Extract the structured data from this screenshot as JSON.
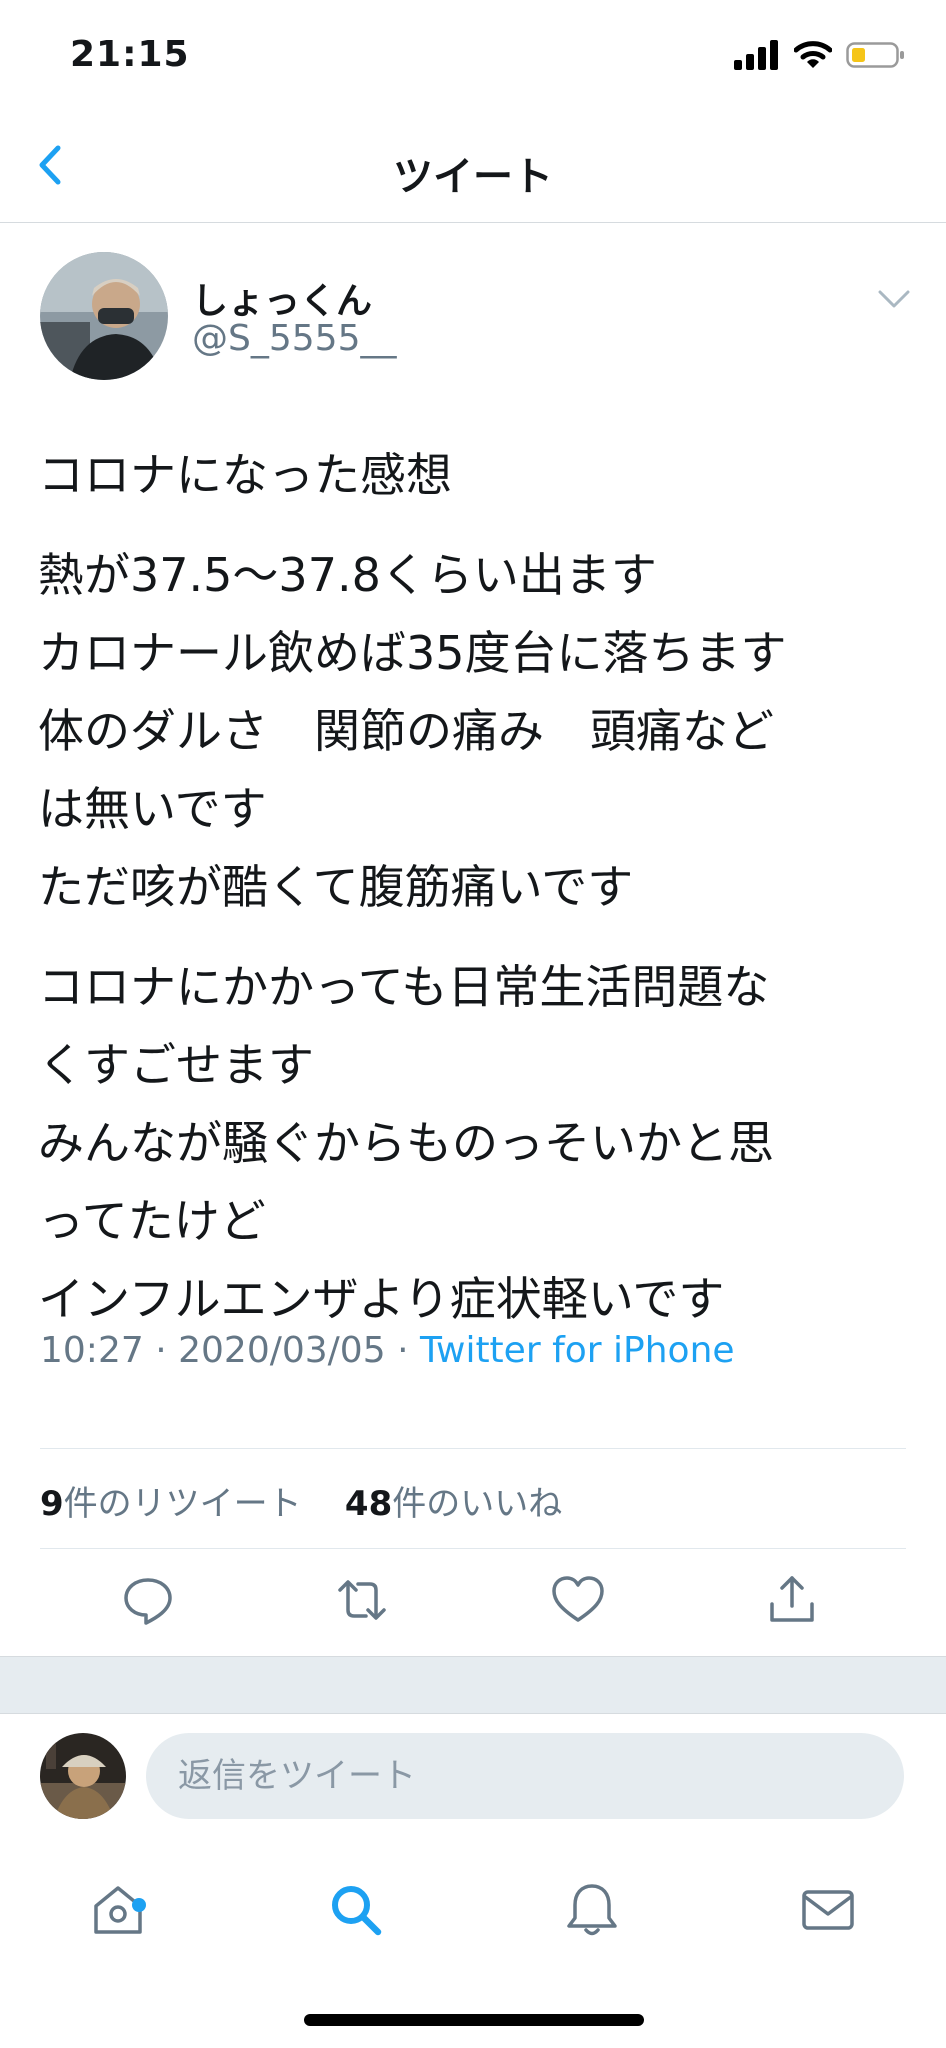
{
  "status_bar": {
    "time": "21:15"
  },
  "nav": {
    "title": "ツイート"
  },
  "tweet": {
    "display_name": "しょっくん",
    "handle": "@S_5555__",
    "paragraphs": [
      [
        "コロナになった感想"
      ],
      [
        "熱が37.5〜37.8くらい出ます",
        "カロナール飲めば35度台に落ちます",
        "体のダルさ　関節の痛み　頭痛など",
        "は無いです",
        "ただ咳が酷くて腹筋痛いです"
      ],
      [
        "コロナにかかっても日常生活問題な",
        "くすごせます",
        "みんなが騒ぐからものっそいかと思",
        "ってたけど",
        "インフルエンザより症状軽いです"
      ]
    ],
    "time": "10:27",
    "date": "2020/03/05",
    "separator": "·",
    "source": "Twitter for iPhone",
    "retweet_count": "9",
    "retweet_label": "件のリツイート",
    "like_count": "48",
    "like_label": "件のいいね"
  },
  "reply": {
    "placeholder": "返信をツイート"
  },
  "icons": {
    "back": "chevron-left-icon",
    "caret": "chevron-down-icon",
    "actions": [
      "reply-icon",
      "retweet-icon",
      "like-icon",
      "share-icon"
    ],
    "tabs": [
      "home-icon",
      "search-icon",
      "notifications-icon",
      "messages-icon"
    ]
  },
  "colors": {
    "accent": "#1da1f2",
    "secondary_text": "#657786",
    "band": "#e6ecf0",
    "battery": "#f5c518"
  }
}
